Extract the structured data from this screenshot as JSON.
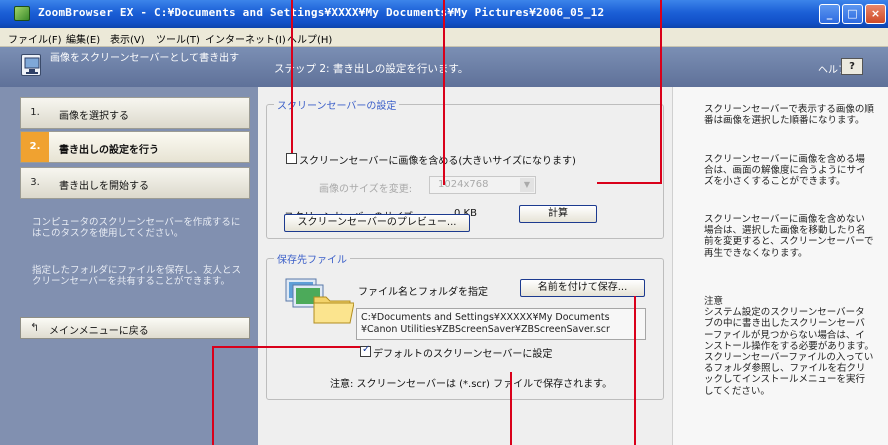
{
  "window": {
    "title": "ZoomBrowser EX  -  C:¥Documents and Settings¥XXXX¥My Documents¥My Pictures¥2006_05_12",
    "controls": {
      "minimize": "_",
      "maximize": "□",
      "close": "×"
    }
  },
  "menu": [
    "ファイル(F)",
    "編集(E)",
    "表示(V)",
    "ツール(T)",
    "インターネット(I)",
    "ヘルプ(H)"
  ],
  "header": {
    "wizard_title": "画像をスクリーンセーバーとして書き出す",
    "step_heading": "ステップ 2:  書き出しの設定を行います。",
    "help_label": "ヘルプ",
    "help_button": "?"
  },
  "steps": [
    {
      "num": "1.",
      "label": "画像を選択する",
      "active": false
    },
    {
      "num": "2.",
      "label": "書き出しの設定を行う",
      "active": true
    },
    {
      "num": "3.",
      "label": "書き出しを開始する",
      "active": false
    }
  ],
  "left_notes": [
    "コンピュータのスクリーンセーバーを作成するにはこのタスクを使用してください。",
    "指定したフォルダにファイルを保存し、友人とスクリーンセーバーを共有することができます。"
  ],
  "back_button": "メインメニューに戻る",
  "screensaver_group": {
    "legend": "スクリーンセーバーの設定",
    "include_images_label": "スクリーンセーバーに画像を含める(大きいサイズになります)",
    "include_images_checked": false,
    "resize_label": "画像のサイズを変更:",
    "resize_value": "1024x768",
    "size_label": "スクリーンセーバーのサイズ:",
    "size_value": "0 KB",
    "calc_button": "計算",
    "preview_button": "スクリーンセーバーのプレビュー..."
  },
  "save_group": {
    "legend": "保存先ファイル",
    "file_label": "ファイル名とフォルダを指定",
    "save_as_button": "名前を付けて保存...",
    "path_line1": "C:¥Documents and Settings¥XXXXX¥My Documents",
    "path_line2": "¥Canon Utilities¥ZBScreenSaver¥ZBScreenSaver.scr",
    "default_label": "デフォルトのスクリーンセーバーに設定",
    "default_checked": true,
    "note": "注意: スクリーンセーバーは (*.scr) ファイルで保存されます。"
  },
  "help_texts": [
    "スクリーンセーバーで表示する画像の順番は画像を選択した順番になります。",
    "スクリーンセーバーに画像を含める場合は、画面の解像度に合うようにサイズを小さくすることができます。",
    "スクリーンセーバーに画像を含めない場合は、選択した画像を移動したり名前を変更すると、スクリーンセーバーで再生できなくなります。",
    "注意\nシステム設定のスクリーンセーバータブの中に書き出したスクリーンセーバーファイルが見つからない場合は、インストール操作をする必要があります。スクリーンセーバーファイルの入っているフォルダ参照し、ファイルを右クリックしてインストールメニューを実行してください。"
  ],
  "colors": {
    "accent_orange": "#f0a230",
    "sidebar_blue": "#8190b0",
    "callout_red": "#d9001a",
    "titlebar_blue": "#1b5fd6"
  }
}
